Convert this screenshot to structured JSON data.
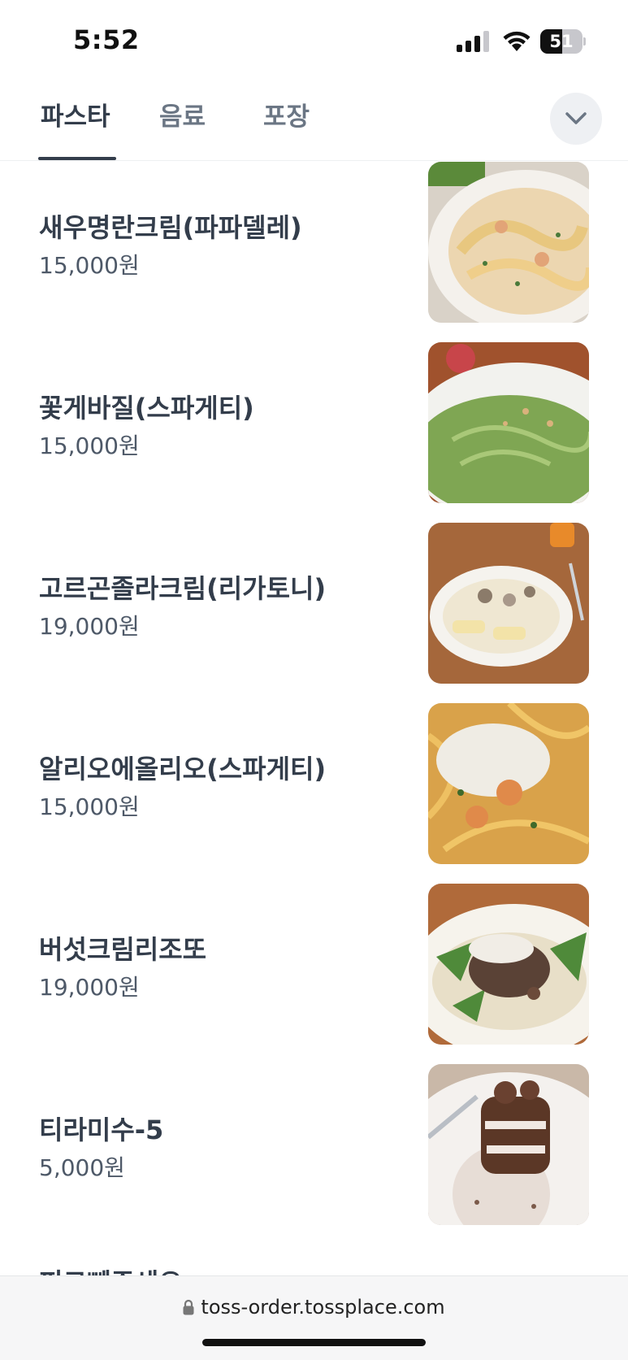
{
  "status_bar": {
    "time": "5:52",
    "battery": "51",
    "battery_level_percent": 51
  },
  "tabs": [
    {
      "label": "파스타",
      "active": true
    },
    {
      "label": "음료",
      "active": false
    },
    {
      "label": "포장",
      "active": false
    }
  ],
  "menu": [
    {
      "name": "새우명란크림(파파델레)",
      "price": "15,000원",
      "photo": "shrimp-pollock-roe-cream-pappardelle"
    },
    {
      "name": "꽃게바질(스파게티)",
      "price": "15,000원",
      "photo": "blue-crab-basil-spaghetti"
    },
    {
      "name": "고르곤졸라크림(리가토니)",
      "price": "19,000원",
      "photo": "gorgonzola-cream-rigatoni"
    },
    {
      "name": "알리오에올리오(스파게티)",
      "price": "15,000원",
      "photo": "aglio-e-olio-spaghetti"
    },
    {
      "name": "버섯크림리조또",
      "price": "19,000원",
      "photo": "mushroom-cream-risotto"
    },
    {
      "name": "티라미수-5",
      "price": "5,000원",
      "photo": "tiramisu"
    },
    {
      "name": "피코뻬주세오",
      "price": "",
      "photo": ""
    }
  ],
  "browser": {
    "url": "toss-order.tossplace.com"
  },
  "colors": {
    "text_primary": "#333d4b",
    "text_secondary": "#6b7684",
    "divider": "#eef0f2"
  }
}
